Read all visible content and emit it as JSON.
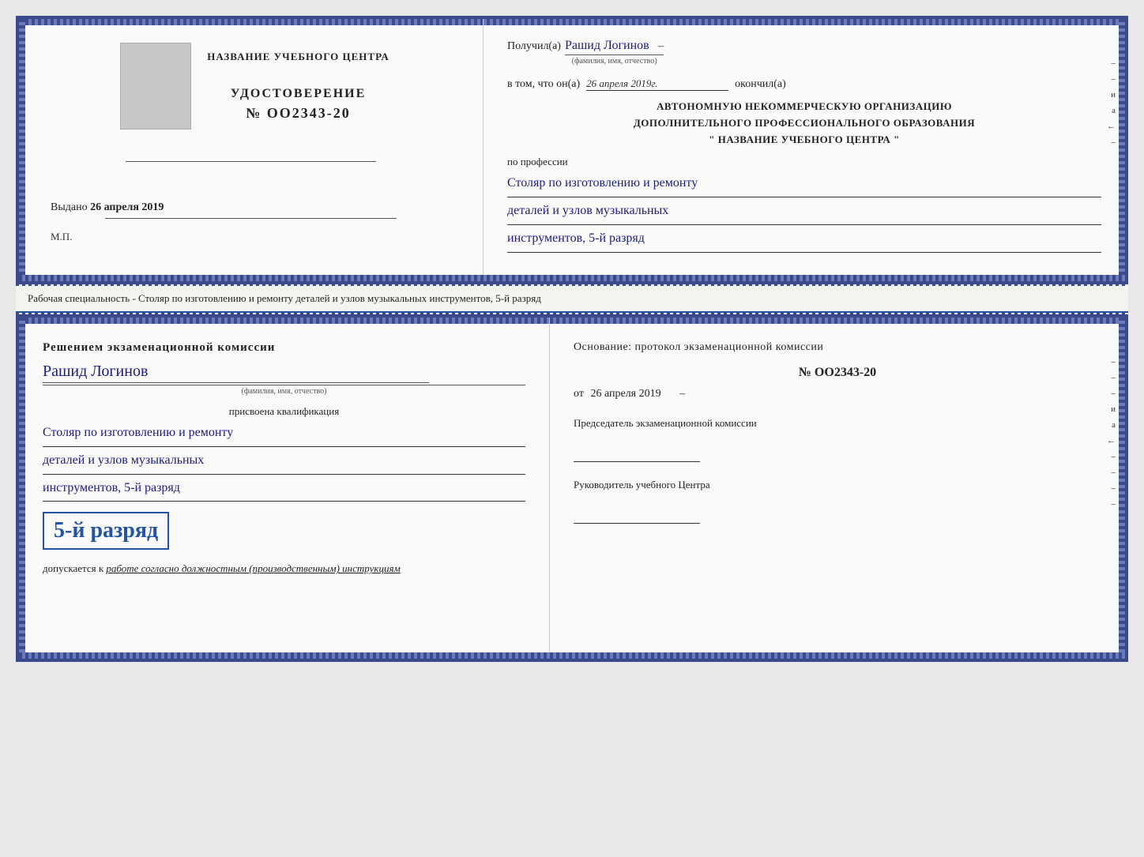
{
  "top_left": {
    "center_name": "НАЗВАНИЕ УЧЕБНОГО ЦЕНТРА",
    "udostoverenie_title": "УДОСТОВЕРЕНИЕ",
    "udostoverenie_number": "№ OO2343-20",
    "vydano_label": "Выдано",
    "vydano_date": "26 апреля 2019",
    "mp_label": "М.П."
  },
  "top_right": {
    "poluchil_label": "Получил(а)",
    "recipient_name": "Рашид Логинов",
    "fio_label": "(фамилия, имя, отчество)",
    "dash": "–",
    "vtom_label": "в том, что он(а)",
    "date_value": "26 апреля 2019г.",
    "okonchill_label": "окончил(а)",
    "org_line1": "АВТОНОМНУЮ НЕКОММЕРЧЕСКУЮ ОРГАНИЗАЦИЮ",
    "org_line2": "ДОПОЛНИТЕЛЬНОГО ПРОФЕССИОНАЛЬНОГО ОБРАЗОВАНИЯ",
    "org_line3": "\"   НАЗВАНИЕ УЧЕБНОГО ЦЕНТРА   \"",
    "po_professii": "по профессии",
    "profession_line1": "Столяр по изготовлению и ремонту",
    "profession_line2": "деталей и узлов музыкальных",
    "profession_line3": "инструментов, 5-й разряд"
  },
  "specialty_label": "Рабочая специальность - Столяр по изготовлению и ремонту деталей и узлов музыкальных инструментов, 5-й разряд",
  "bottom_left": {
    "resheniem_title": "Решением экзаменационной комиссии",
    "recipient_name": "Рашид Логинов",
    "fio_label": "(фамилия, имя, отчество)",
    "prisvoyena": "присвоена квалификация",
    "qualification_line1": "Столяр по изготовлению и ремонту",
    "qualification_line2": "деталей и узлов музыкальных",
    "qualification_line3": "инструментов, 5-й разряд",
    "rank_text": "5-й разряд",
    "dopuskaetsya_label": "допускается к",
    "dopuskaetsya_text": "работе согласно должностным (производственным) инструкциям"
  },
  "bottom_right": {
    "osnovanie_label": "Основание: протокол экзаменационной комиссии",
    "protocol_number": "№ OO2343-20",
    "ot_label": "от",
    "ot_date": "26 апреля 2019",
    "chairman_label": "Председатель экзаменационной комиссии",
    "rukovoditel_label": "Руководитель учебного Центра",
    "decorations": [
      "–",
      "–",
      "–",
      "и",
      "а",
      "←",
      "–",
      "–",
      "–",
      "–",
      "–"
    ]
  }
}
